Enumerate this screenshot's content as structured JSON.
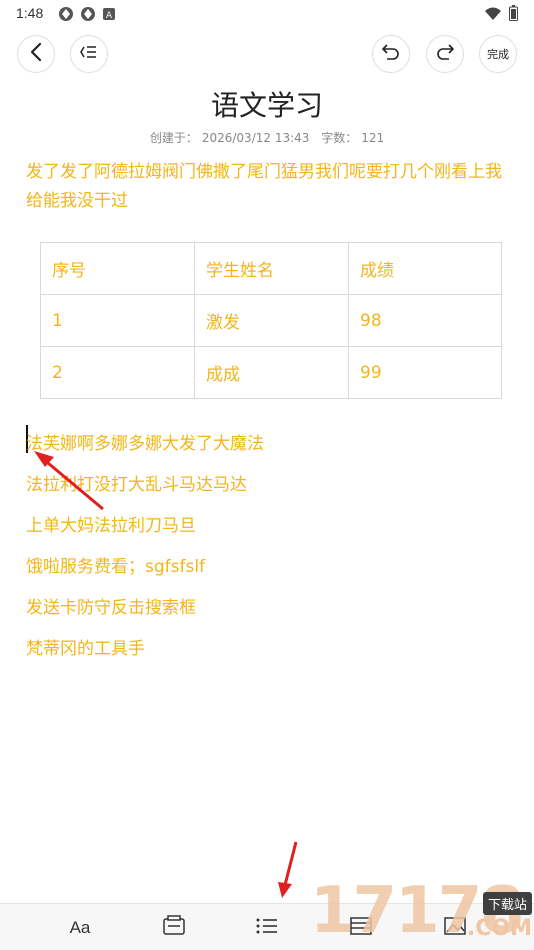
{
  "status_bar": {
    "time": "1:48",
    "icons": [
      "app-icon",
      "app-icon",
      "a-icon"
    ],
    "right_icons": [
      "wifi-icon",
      "battery-icon"
    ]
  },
  "toolbar": {
    "back_icon": "back-arrow-icon",
    "outline_icon": "outline-icon",
    "undo_icon": "undo-icon",
    "redo_icon": "redo-icon",
    "done_label": "完成"
  },
  "note": {
    "title": "语文学习",
    "created_label": "创建于：",
    "created_at": "2026/03/12 13:43",
    "wordcount_label": "字数：",
    "wordcount": "121",
    "paragraph1": "发了发了阿德拉姆阀门佛撒了尾门猛男我们呢要打几个刚看上我给能我没干过",
    "table": {
      "header": [
        "序号",
        "学生姓名",
        "成绩"
      ],
      "rows": [
        [
          "1",
          "激发",
          "98"
        ],
        [
          "2",
          "成成",
          "99"
        ]
      ]
    },
    "lines": [
      "法芙娜啊多娜多娜大发了大魔法",
      "法拉利打没打大乱斗马达马达",
      "上单大妈法拉利刀马旦",
      "饿啦服务费看；sgfsfslf",
      "发送卡防守反击搜索框",
      "梵蒂冈的工具⼿"
    ],
    "accent_color": "#f3b51a"
  },
  "bottom_bar": {
    "font_label": "Aa",
    "items": [
      "font-style-button",
      "template-button",
      "list-button",
      "table-button",
      "image-button"
    ]
  },
  "watermark": {
    "digits": "17178",
    "badge": "下载站",
    "suffix": ".COM"
  }
}
